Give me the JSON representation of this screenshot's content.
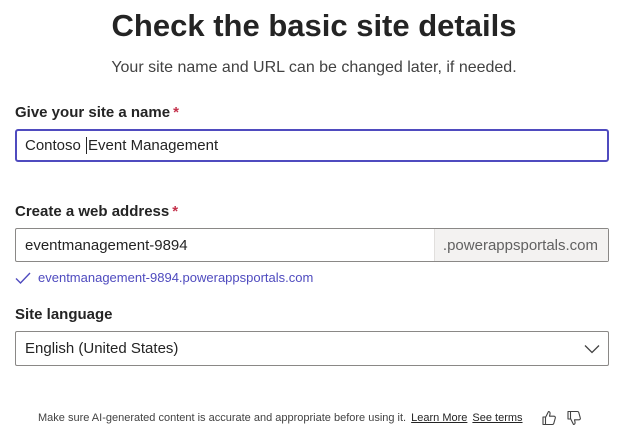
{
  "header": {
    "title": "Check the basic site details",
    "subtitle": "Your site name and URL can be changed later, if needed."
  },
  "site_name": {
    "label": "Give your site a name",
    "required_mark": "*",
    "value_before_caret": "Contoso ",
    "value_after_caret": "Event Management"
  },
  "web_address": {
    "label": "Create a web address",
    "required_mark": "*",
    "value": "eventmanagement-9894",
    "suffix": ".powerappsportals.com",
    "validated_url": "eventmanagement-9894.powerappsportals.com"
  },
  "site_language": {
    "label": "Site language",
    "selected": "English (United States)"
  },
  "footer": {
    "disclaimer": "Make sure AI-generated content is accurate and appropriate before using it.",
    "learn_more": "Learn More",
    "see_terms": "See terms"
  },
  "colors": {
    "accent": "#4f4bbf",
    "required": "#c4314b"
  },
  "icons": {
    "validated": "checkmark-icon",
    "dropdown": "chevron-down-icon",
    "like": "thumbs-up-icon",
    "dislike": "thumbs-down-icon"
  }
}
